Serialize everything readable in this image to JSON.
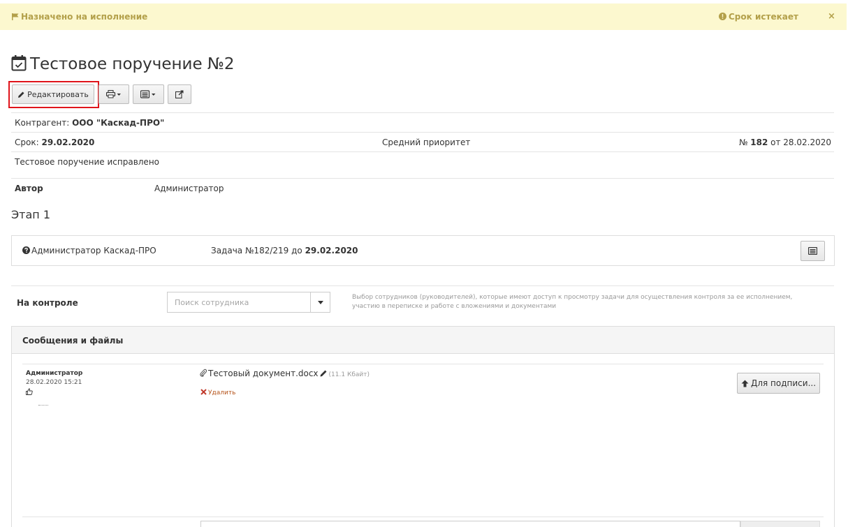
{
  "alert": {
    "status_label": "Назначено на исполнение",
    "deadline_label": "Срок истекает",
    "close_symbol": "×",
    "color": "#b3a04a",
    "background": "#fcf8cf"
  },
  "title": "Тестовое поручение №2",
  "toolbar": {
    "edit_label": "Редактировать",
    "highlight_color": "#e0141b"
  },
  "details": {
    "counterparty_label": "Контрагент:",
    "counterparty_value": "ООО \"Каскад-ПРО\"",
    "deadline_label": "Срок:",
    "deadline_value": "29.02.2020",
    "priority": "Средний приоритет",
    "number_prefix": "№",
    "number_value": "182",
    "number_suffix": "от 28.02.2020",
    "description": "Тестовое поручение исправлено",
    "author_label": "Автор",
    "author_value": "Администратор"
  },
  "stage": {
    "title": "Этап 1",
    "assignee": "Администратор Каскад-ПРО",
    "task_prefix": "Задача №182/219 до",
    "task_date": "29.02.2020"
  },
  "control": {
    "label": "На контроле",
    "search_placeholder": "Поиск сотрудника",
    "hint": "Выбор сотрудников (руководителей), которые имеют доступ к просмотру задачи для осуществления контроля за ее исполнением, участию в переписке и работе с вложениями и документами"
  },
  "messages": {
    "header": "Сообщения и файлы",
    "items": [
      {
        "author": "Администратор",
        "datetime": "28.02.2020 15:21",
        "file_name": "Тестовый документ.docx",
        "file_size": "(11.1 Кбайт)",
        "delete_label": "Удалить",
        "sign_button": "Для подписи..."
      }
    ]
  }
}
